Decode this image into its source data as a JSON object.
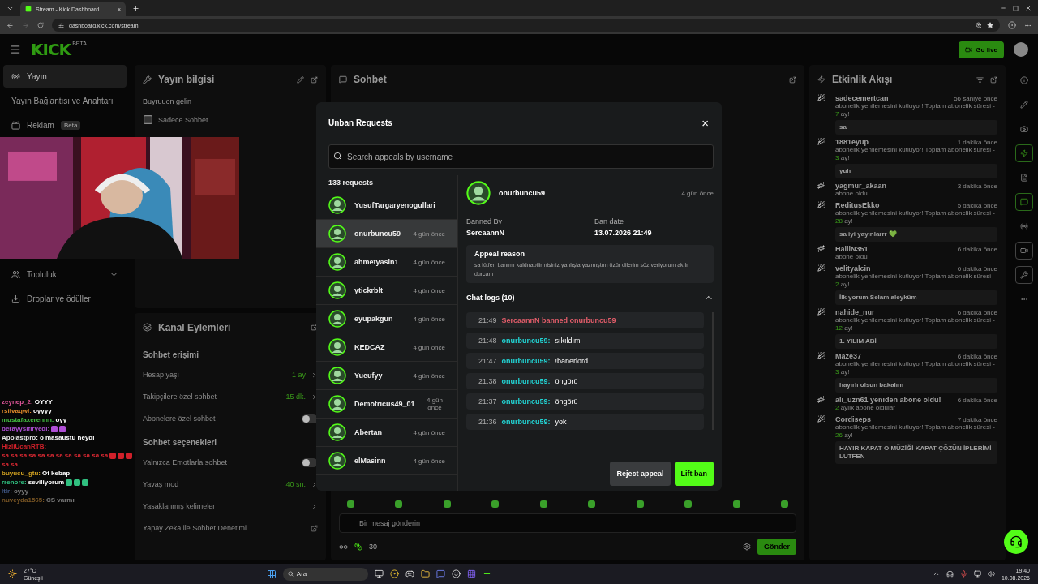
{
  "browser": {
    "tab_title": "Stream - Kick Dashboard",
    "tab_close": "×",
    "url": "dashboard.kick.com/stream"
  },
  "header": {
    "logo": "KICK",
    "logo_badge": "BETA",
    "go_live": "Go live"
  },
  "sidebar": {
    "items": [
      {
        "label": "Yayın",
        "selected": true
      },
      {
        "label": "Yayın Bağlantısı ve Anahtarı",
        "selected": false
      },
      {
        "label": "Reklam",
        "badge": "Beta",
        "selected": false
      }
    ],
    "lower_items": [
      {
        "label": "Topluluk",
        "expandable": true
      },
      {
        "label": "Droplar ve ödüller",
        "expandable": false
      }
    ]
  },
  "stream_info": {
    "title": "Yayın bilgisi",
    "stream_title": "Buyruuon gelin",
    "category": "Sadece Sohbet"
  },
  "channel_actions": {
    "title": "Kanal Eylemleri",
    "sections": [
      {
        "title": "Sohbet erişimi",
        "rows": [
          {
            "kind": "value",
            "label": "Hesap yaşı",
            "value": "1 ay"
          },
          {
            "kind": "value",
            "label": "Takipçilere özel sohbet",
            "value": "15 dk."
          },
          {
            "kind": "toggle",
            "label": "Abonelere özel sohbet",
            "on": false
          }
        ]
      },
      {
        "title": "Sohbet seçenekleri",
        "rows": [
          {
            "kind": "toggle",
            "label": "Yalnızca Emotlarla sohbet",
            "on": false
          },
          {
            "kind": "value",
            "label": "Yavaş mod",
            "value": "40 sn."
          },
          {
            "kind": "link",
            "label": "Yasaklanmış kelimeler"
          },
          {
            "kind": "external",
            "label": "Yapay Zeka ile Sohbet Denetimi"
          }
        ]
      }
    ]
  },
  "chat": {
    "title": "Sohbet",
    "placeholder": "Bir mesaj gönderin",
    "points": "30",
    "send": "Gönder"
  },
  "activity": {
    "title": "Etkinlik Akışı",
    "events": [
      {
        "kind": "resub",
        "name": "sadecemertcan",
        "time": "56 saniye önce",
        "detail": "abonelik yenilemesini kutluyor! Toplam abonelik süresi -",
        "months": "7",
        "unit": "ay!",
        "message": "sa"
      },
      {
        "kind": "resub",
        "name": "1881eyup",
        "time": "1 dakika önce",
        "detail": "abonelik yenilemesini kutluyor! Toplam abonelik süresi -",
        "months": "3",
        "unit": "ay!",
        "message": "yuh"
      },
      {
        "kind": "sub",
        "name": "yagmur_akaan",
        "time": "3 dakika önce",
        "detail": "abone oldu"
      },
      {
        "kind": "resub",
        "name": "ReditusEkko",
        "time": "5 dakika önce",
        "detail": "abonelik yenilemesini kutluyor! Toplam abonelik süresi -",
        "months": "28",
        "unit": "ay!",
        "message": "sa iyi yayınlarrr 💚"
      },
      {
        "kind": "sub",
        "name": "HalilN351",
        "time": "6 dakika önce",
        "detail": "abone oldu"
      },
      {
        "kind": "resub",
        "name": "velityalcin",
        "time": "6 dakika önce",
        "detail": "abonelik yenilemesini kutluyor! Toplam abonelik süresi -",
        "months": "2",
        "unit": "ay!",
        "message": "İlk yorum Selam aleyküm"
      },
      {
        "kind": "resub",
        "name": "nahide_nur",
        "time": "6 dakika önce",
        "detail": "abonelik yenilemesini kutluyor! Toplam abonelik süresi -",
        "months": "12",
        "unit": "ay!",
        "message": "1. YILIM ABİ"
      },
      {
        "kind": "resub",
        "name": "Maze37",
        "time": "6 dakika önce",
        "detail": "abonelik yenilemesini kutluyor! Toplam abonelik süresi -",
        "months": "3",
        "unit": "ay!",
        "message": "hayırlı olsun bakalım"
      },
      {
        "kind": "sub",
        "name": "ali_uzn61 yeniden abone oldu!",
        "time": "6 dakika önce",
        "months": "2",
        "unit": "aylık abone oldular"
      },
      {
        "kind": "resub",
        "name": "Cordiseps",
        "time": "7 dakika önce",
        "detail": "abonelik yenilemesini kutluyor! Toplam abonelik süresi -",
        "months": "26",
        "unit": "ay!",
        "message": "HAYIR KAPAT O MÜZİĞİ KAPAT ÇÖZÜN İPLERİMİ LÜTFEN"
      }
    ]
  },
  "rail": [
    {
      "kind": "info",
      "active": false,
      "outlined": false
    },
    {
      "kind": "pencil",
      "active": false,
      "outlined": false
    },
    {
      "kind": "camera",
      "active": false,
      "outlined": false
    },
    {
      "kind": "zap",
      "active": true,
      "outlined": true
    },
    {
      "kind": "doc",
      "active": false,
      "outlined": false
    },
    {
      "kind": "chat",
      "active": true,
      "outlined": true
    },
    {
      "kind": "broadcast",
      "active": false,
      "outlined": false
    },
    {
      "kind": "video",
      "active": false,
      "outlined": true
    },
    {
      "kind": "wrench",
      "active": false,
      "outlined": true
    },
    {
      "kind": "dots",
      "active": false,
      "outlined": false
    }
  ],
  "overlay_chat": [
    {
      "user": "zeynep_2:",
      "color": "#e0559a",
      "faded": false,
      "parts": [
        {
          "kind": "text",
          "text": "OYYY"
        }
      ]
    },
    {
      "user": "rsilvaqwl:",
      "color": "#e08a2a",
      "faded": false,
      "parts": [
        {
          "kind": "text",
          "text": "oyyyy"
        }
      ]
    },
    {
      "user": "mustafaxerennn:",
      "color": "#44c044",
      "faded": false,
      "parts": [
        {
          "kind": "text",
          "text": "oyy"
        }
      ]
    },
    {
      "user": "berayysifiryedi:",
      "color": "#b04fd6",
      "faded": false,
      "parts": [
        {
          "kind": "emote"
        },
        {
          "kind": "emote"
        }
      ]
    },
    {
      "user": "Apolastpro:",
      "color": "#e8e8e8",
      "faded": false,
      "parts": [
        {
          "kind": "text",
          "text": "o masaüstü neydi"
        }
      ]
    },
    {
      "user": "HizliUcanRTB:",
      "color": "#d0202a",
      "faded": false,
      "parts": [
        {
          "kind": "red",
          "text": "sa sa sa sa sa sa sa sa sa sa sa sa"
        },
        {
          "kind": "emote"
        },
        {
          "kind": "emote"
        },
        {
          "kind": "emote"
        },
        {
          "kind": "red",
          "text": "sa sa"
        }
      ]
    },
    {
      "user": "buyucu_gtu:",
      "color": "#d0a020",
      "faded": false,
      "parts": [
        {
          "kind": "text",
          "text": "Of kebap"
        }
      ]
    },
    {
      "user": "rrenore:",
      "color": "#30c080",
      "faded": false,
      "parts": [
        {
          "kind": "text",
          "text": "seviliyorum"
        },
        {
          "kind": "emote"
        },
        {
          "kind": "emote"
        },
        {
          "kind": "emote"
        }
      ]
    },
    {
      "user": "ltlr:",
      "color": "#3e5480",
      "faded": true,
      "parts": [
        {
          "kind": "text",
          "text": "oyyy"
        }
      ]
    },
    {
      "user": "nuveyda1565:",
      "color": "#7a5624",
      "faded": true,
      "parts": [
        {
          "kind": "text",
          "text": "CS varmı"
        }
      ]
    }
  ],
  "modal": {
    "title": "Unban Requests",
    "close": "×",
    "search_placeholder": "Search appeals by username",
    "count": "133 requests",
    "requests": [
      {
        "name": "YusufTargaryenogullari",
        "selected": false
      },
      {
        "name": "onurbuncu59",
        "time": "4 gün önce",
        "selected": true
      },
      {
        "name": "ahmetyasin1",
        "time": "4 gün önce",
        "selected": false
      },
      {
        "name": "ytickrblt",
        "time": "4 gün önce",
        "selected": false
      },
      {
        "name": "eyupakgun",
        "time": "4 gün önce",
        "selected": false
      },
      {
        "name": "KEDCAZ",
        "time": "4 gün önce",
        "selected": false
      },
      {
        "name": "Yueufyy",
        "time": "4 gün önce",
        "selected": false
      },
      {
        "name": "Demotricus49_01",
        "time": "4 gün önce",
        "selected": false
      },
      {
        "name": "Abertan",
        "time": "4 gün önce",
        "selected": false
      },
      {
        "name": "elMasinn",
        "time": "4 gün önce",
        "selected": false
      }
    ],
    "detail": {
      "name": "onurbuncu59",
      "time": "4 gün önce",
      "banned_by_label": "Banned By",
      "banned_by": "SercaannN",
      "ban_date_label": "Ban date",
      "ban_date": "13.07.2026 21:49",
      "reason_title": "Appeal reason",
      "reason": "sa lütfen banımı kaldırabilirmisiniz yanlışla yazmıştım özür dilerim söz veriyorum akılı durcam",
      "logs_title": "Chat logs (10)",
      "logs_expanded": true,
      "logs": [
        {
          "kind": "ban",
          "time": "21:49",
          "text": "SercaannN banned onurbuncu59"
        },
        {
          "kind": "message",
          "time": "21:48",
          "user": "onurbuncu59:",
          "text": "sıkıldım"
        },
        {
          "kind": "message",
          "time": "21:47",
          "user": "onurbuncu59:",
          "text": "!banerlord"
        },
        {
          "kind": "message",
          "time": "21:38",
          "user": "onurbuncu59:",
          "text": "öngörü"
        },
        {
          "kind": "message",
          "time": "21:37",
          "user": "onurbuncu59:",
          "text": "öngörü"
        },
        {
          "kind": "message",
          "time": "21:36",
          "user": "onurbuncu59:",
          "text": "yok"
        }
      ]
    },
    "reject": "Reject appeal",
    "lift": "Lift ban"
  },
  "taskbar": {
    "temperature": "27°C",
    "weather": "Güneşli",
    "search": "Ara",
    "time": "19:40",
    "date": "10.08.2026"
  }
}
